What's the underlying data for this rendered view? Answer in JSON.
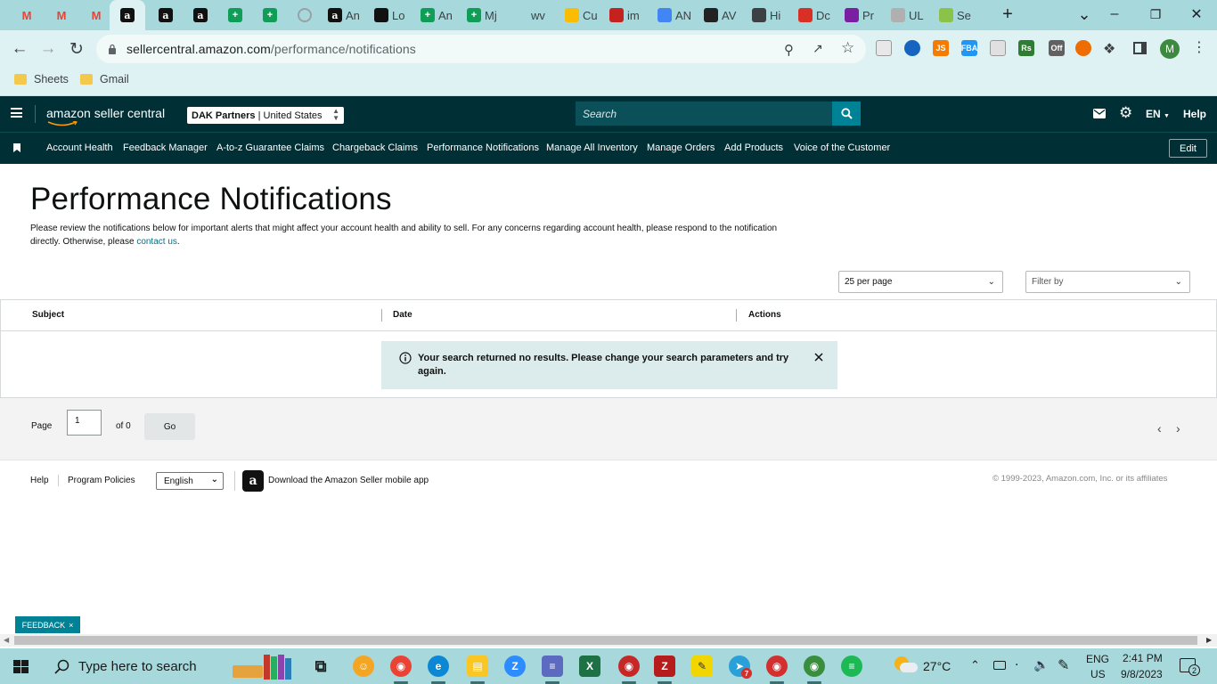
{
  "browser": {
    "tabs": [
      {
        "label": "",
        "icon": "gmail-icon",
        "color": "#ea4335"
      },
      {
        "label": "",
        "icon": "gmail-icon",
        "color": "#ea4335"
      },
      {
        "label": "",
        "icon": "gmail-icon",
        "color": "#ea4335"
      },
      {
        "label": "",
        "icon": "amazon-icon",
        "color": "#111111"
      },
      {
        "label": "",
        "icon": "amazon-icon",
        "color": "#111111"
      },
      {
        "label": "",
        "icon": "amazon-icon",
        "color": "#111111"
      },
      {
        "label": "",
        "icon": "sheets-icon",
        "color": "#0f9d58"
      },
      {
        "label": "",
        "icon": "sheets-icon",
        "color": "#0f9d58"
      },
      {
        "label": "",
        "icon": "globe-icon",
        "color": "#9aa0a6"
      },
      {
        "label": "An",
        "icon": "amazon-icon",
        "color": "#111111"
      },
      {
        "label": "Lo",
        "icon": "pirate-icon",
        "color": "#111111"
      },
      {
        "label": "An",
        "icon": "sheets-icon",
        "color": "#0f9d58"
      },
      {
        "label": "Mj",
        "icon": "sheets-icon",
        "color": "#0f9d58"
      },
      {
        "label": "wv",
        "icon": "blank-icon",
        "color": "#a7d9dc"
      },
      {
        "label": "Cu",
        "icon": "drive-icon",
        "color": "#fbbc04"
      },
      {
        "label": "im",
        "icon": "shield-icon",
        "color": "#c5221f"
      },
      {
        "label": "AN",
        "icon": "pencil-icon",
        "color": "#4285f4"
      },
      {
        "label": "AV",
        "icon": "c-icon",
        "color": "#222222"
      },
      {
        "label": "Hi",
        "icon": "history-icon",
        "color": "#3c4043"
      },
      {
        "label": "Dc",
        "icon": "heart-icon",
        "color": "#d93025"
      },
      {
        "label": "Pr",
        "icon": "list-icon",
        "color": "#7b1fa2"
      },
      {
        "label": "UL",
        "icon": "uline-icon",
        "color": "#b0b0b0"
      },
      {
        "label": "Se",
        "icon": "leaf-icon",
        "color": "#8bc34a"
      }
    ],
    "window_controls": [
      "tab-search",
      "minimize",
      "maximize",
      "close"
    ],
    "url_host": "sellercentral.amazon.com",
    "url_path": "/performance/notifications",
    "bookmarks": [
      "Sheets",
      "Gmail"
    ],
    "extensions": [
      {
        "icon": "ext-wallet-icon",
        "color": "#e8e8e8",
        "text": ""
      },
      {
        "icon": "ext-blue-circle-icon",
        "color": "#1565c0",
        "text": ""
      },
      {
        "icon": "ext-js-icon",
        "color": "#f57c00",
        "text": "JS"
      },
      {
        "icon": "ext-fba-icon",
        "color": "#2196f3",
        "text": "FBA"
      },
      {
        "icon": "ext-card-icon",
        "color": "#e0e0e0",
        "text": ""
      },
      {
        "icon": "ext-rs-icon",
        "color": "#2e7d32",
        "text": "Rs"
      },
      {
        "icon": "ext-off-icon",
        "color": "#616161",
        "text": "Off"
      },
      {
        "icon": "ext-orange-icon",
        "color": "#ef6c00",
        "text": ""
      }
    ],
    "profile_initial": "M"
  },
  "seller": {
    "logo": "amazon seller central",
    "account": "DAK Partners",
    "marketplace": "United States",
    "search_placeholder": "Search",
    "language": "EN",
    "help": "Help",
    "nav_items": [
      "Account Health",
      "Feedback Manager",
      "A-to-z Guarantee Claims",
      "Chargeback Claims",
      "Performance Notifications",
      "Manage All Inventory",
      "Manage Orders",
      "Add Products",
      "Voice of the Customer"
    ],
    "edit": "Edit"
  },
  "page": {
    "title": "Performance Notifications",
    "intro_text": "Please review the notifications below for important alerts that might affect your account health and ability to sell. For any concerns regarding account health, please respond to the notification directly. Otherwise, please ",
    "intro_link": "contact us",
    "intro_end": ".",
    "per_page": "25 per page",
    "filter": "Filter by",
    "columns": [
      "Subject",
      "Date",
      "Actions"
    ],
    "alert": "Your search returned no results. Please change your search parameters and try again.",
    "pager": {
      "page_label": "Page",
      "page_value": "1",
      "of_label": "of 0",
      "go": "Go"
    }
  },
  "footer": {
    "help": "Help",
    "program_policies": "Program Policies",
    "language": "English",
    "app_text": "Download the Amazon Seller mobile app",
    "copyright": "© 1999-2023, Amazon.com, Inc. or its affiliates"
  },
  "feedback": "FEEDBACK",
  "taskbar": {
    "search_placeholder": "Type here to search",
    "apps": [
      {
        "icon": "task-view-icon",
        "color": "#a7d9dc"
      },
      {
        "icon": "emoji-app-icon",
        "color": "#f4a523"
      },
      {
        "icon": "chrome-icon",
        "color": "#ea4335"
      },
      {
        "icon": "edge-icon",
        "color": "#0c87d3"
      },
      {
        "icon": "file-explorer-icon",
        "color": "#f9c623"
      },
      {
        "icon": "zoom-icon",
        "color": "#2d8cff"
      },
      {
        "icon": "calculator-icon",
        "color": "#5c6bc0"
      },
      {
        "icon": "excel-icon",
        "color": "#1e7145"
      },
      {
        "icon": "chrome-profile-icon",
        "color": "#c62828"
      },
      {
        "icon": "filezilla-icon",
        "color": "#b71c1c"
      },
      {
        "icon": "sticky-notes-icon",
        "color": "#f2d600"
      },
      {
        "icon": "telegram-icon",
        "color": "#2aa0d8"
      },
      {
        "icon": "chrome-profile2-icon",
        "color": "#d32f2f"
      },
      {
        "icon": "chrome-profile3-icon",
        "color": "#388e3c"
      },
      {
        "icon": "spotify-icon",
        "color": "#1db954"
      }
    ],
    "weather": "27°C",
    "language_top": "ENG",
    "language_bottom": "US",
    "time": "2:41 PM",
    "date": "9/8/2023",
    "notification_count": "2",
    "telegram_badge": "7"
  }
}
